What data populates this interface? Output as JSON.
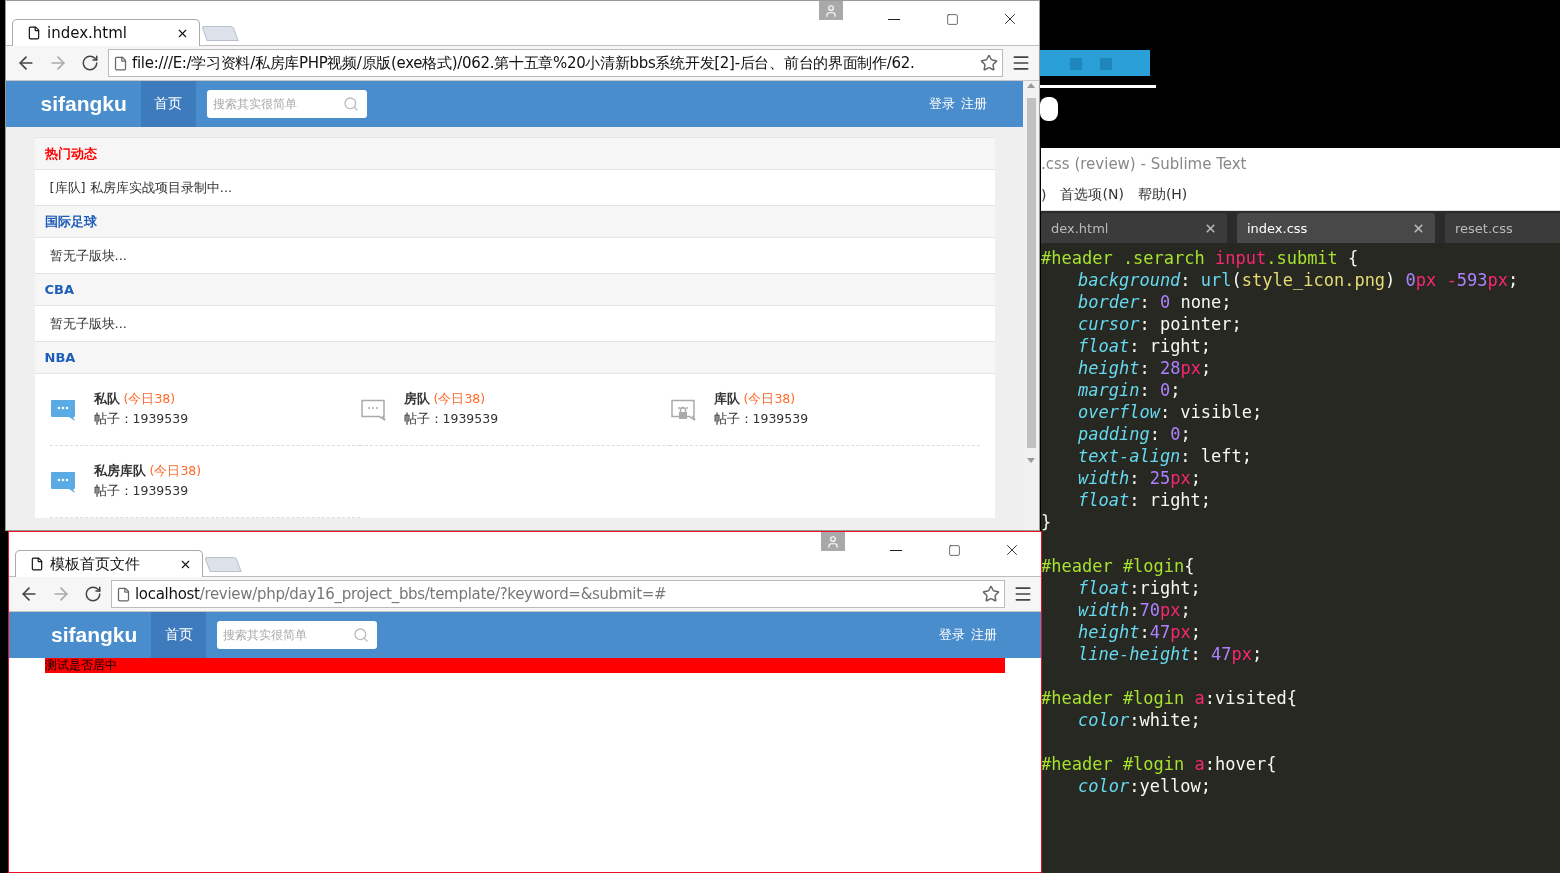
{
  "browsers": [
    {
      "kind": "forum",
      "active": false,
      "tab_title": "index.html",
      "url_parts": [
        {
          "text": "file:///E:/学习资料/私房库PHP视频/原版(exe格式)/062.第十五章%20小清新bbs系统开发[2]-后台、前台的界面制作/62.",
          "dim": false
        }
      ],
      "site": {
        "logo": "sifangku",
        "nav": "首页",
        "search_placeholder": "搜索其实很简单",
        "login": "登录",
        "register": "注册"
      },
      "sections": [
        {
          "title": "热门动态",
          "color": "#ff0000",
          "kind": "text",
          "text": "[库队] 私房库实战项目录制中..."
        },
        {
          "title": "国际足球",
          "color": "#1e5db8",
          "kind": "text",
          "text": "暂无子版块..."
        },
        {
          "title": "CBA",
          "color": "#1e5db8",
          "kind": "text",
          "text": "暂无子版块..."
        },
        {
          "title": "NBA",
          "color": "#1e5db8",
          "kind": "boards",
          "boards": [
            {
              "name": "私队",
              "today": "(今日38)",
              "posts": "帖子：1939539",
              "kind": "new"
            },
            {
              "name": "房队",
              "today": "(今日38)",
              "posts": "帖子：1939539",
              "kind": "plain"
            },
            {
              "name": "库队",
              "today": "(今日38)",
              "posts": "帖子：1939539",
              "kind": "locked"
            },
            {
              "name": "私房库队",
              "today": "(今日38)",
              "posts": "帖子：1939539",
              "kind": "new"
            }
          ]
        }
      ]
    },
    {
      "kind": "test",
      "active": true,
      "tab_title": "模板首页文件",
      "url_parts": [
        {
          "text": "localhost",
          "dim": false
        },
        {
          "text": "/review/php/day16_project_bbs/template/?keyword=&submit=#",
          "dim": true
        }
      ],
      "site": {
        "logo": "sifangku",
        "nav": "首页",
        "search_placeholder": "搜索其实很简单",
        "login": "登录",
        "register": "注册"
      },
      "banner": "测试是否居中"
    }
  ],
  "editor": {
    "title": ".css (review) - Sublime Text",
    "menu": [
      ")",
      "首选项(N)",
      "帮助(H)"
    ],
    "tabs": [
      {
        "label": "dex.html",
        "selected": false
      },
      {
        "label": "index.css",
        "selected": true
      },
      {
        "label": "reset.css",
        "selected": false
      }
    ],
    "blocks": [
      {
        "lines": [
          {
            "indent": false,
            "tokens": [
              {
                "kind": "sel",
                "text": "#header .serarch "
              },
              {
                "kind": "tag",
                "text": "input"
              },
              {
                "kind": "sel",
                "text": ".submit"
              },
              {
                "kind": "plain",
                "text": " {"
              }
            ]
          },
          {
            "indent": true,
            "tokens": [
              {
                "kind": "prop",
                "text": "background"
              },
              {
                "kind": "plain",
                "text": ": "
              },
              {
                "kind": "fn",
                "text": "url"
              },
              {
                "kind": "plain",
                "text": "("
              },
              {
                "kind": "str",
                "text": "style_icon.png"
              },
              {
                "kind": "plain",
                "text": ") "
              },
              {
                "kind": "num",
                "text": "0"
              },
              {
                "kind": "unit",
                "text": "px"
              },
              {
                "kind": "unit",
                "text": " -"
              },
              {
                "kind": "num",
                "text": "593"
              },
              {
                "kind": "unit",
                "text": "px"
              },
              {
                "kind": "plain",
                "text": ";"
              }
            ]
          },
          {
            "indent": true,
            "tokens": [
              {
                "kind": "prop",
                "text": "border"
              },
              {
                "kind": "plain",
                "text": ": "
              },
              {
                "kind": "num",
                "text": "0"
              },
              {
                "kind": "plain",
                "text": " none;"
              }
            ]
          },
          {
            "indent": true,
            "tokens": [
              {
                "kind": "prop",
                "text": "cursor"
              },
              {
                "kind": "plain",
                "text": ": pointer;"
              }
            ]
          },
          {
            "indent": true,
            "tokens": [
              {
                "kind": "prop",
                "text": "float"
              },
              {
                "kind": "plain",
                "text": ": right;"
              }
            ]
          },
          {
            "indent": true,
            "tokens": [
              {
                "kind": "prop",
                "text": "height"
              },
              {
                "kind": "plain",
                "text": ": "
              },
              {
                "kind": "num",
                "text": "28"
              },
              {
                "kind": "unit",
                "text": "px"
              },
              {
                "kind": "plain",
                "text": ";"
              }
            ]
          },
          {
            "indent": true,
            "tokens": [
              {
                "kind": "prop",
                "text": "margin"
              },
              {
                "kind": "plain",
                "text": ": "
              },
              {
                "kind": "num",
                "text": "0"
              },
              {
                "kind": "plain",
                "text": ";"
              }
            ]
          },
          {
            "indent": true,
            "tokens": [
              {
                "kind": "prop",
                "text": "overflow"
              },
              {
                "kind": "plain",
                "text": ": visible;"
              }
            ]
          },
          {
            "indent": true,
            "tokens": [
              {
                "kind": "prop",
                "text": "padding"
              },
              {
                "kind": "plain",
                "text": ": "
              },
              {
                "kind": "num",
                "text": "0"
              },
              {
                "kind": "plain",
                "text": ";"
              }
            ]
          },
          {
            "indent": true,
            "tokens": [
              {
                "kind": "prop",
                "text": "text-align"
              },
              {
                "kind": "plain",
                "text": ": left;"
              }
            ]
          },
          {
            "indent": true,
            "tokens": [
              {
                "kind": "prop",
                "text": "width"
              },
              {
                "kind": "plain",
                "text": ": "
              },
              {
                "kind": "num",
                "text": "25"
              },
              {
                "kind": "unit",
                "text": "px"
              },
              {
                "kind": "plain",
                "text": ";"
              }
            ]
          },
          {
            "indent": true,
            "tokens": [
              {
                "kind": "prop",
                "text": "float"
              },
              {
                "kind": "plain",
                "text": ": right;"
              }
            ]
          },
          {
            "indent": false,
            "tokens": [
              {
                "kind": "plain",
                "text": "}"
              }
            ]
          }
        ]
      },
      {
        "lines": [
          {
            "indent": false,
            "tokens": [
              {
                "kind": "sel",
                "text": "#header #login"
              },
              {
                "kind": "plain",
                "text": "{"
              }
            ]
          },
          {
            "indent": true,
            "tokens": [
              {
                "kind": "prop",
                "text": "float"
              },
              {
                "kind": "plain",
                "text": ":right;"
              }
            ]
          },
          {
            "indent": true,
            "tokens": [
              {
                "kind": "prop",
                "text": "width"
              },
              {
                "kind": "plain",
                "text": ":"
              },
              {
                "kind": "num",
                "text": "70"
              },
              {
                "kind": "unit",
                "text": "px"
              },
              {
                "kind": "plain",
                "text": ";"
              }
            ]
          },
          {
            "indent": true,
            "tokens": [
              {
                "kind": "prop",
                "text": "height"
              },
              {
                "kind": "plain",
                "text": ":"
              },
              {
                "kind": "num",
                "text": "47"
              },
              {
                "kind": "unit",
                "text": "px"
              },
              {
                "kind": "plain",
                "text": ";"
              }
            ]
          },
          {
            "indent": true,
            "tokens": [
              {
                "kind": "prop",
                "text": "line-height"
              },
              {
                "kind": "plain",
                "text": ": "
              },
              {
                "kind": "num",
                "text": "47"
              },
              {
                "kind": "unit",
                "text": "px"
              },
              {
                "kind": "plain",
                "text": ";"
              }
            ]
          }
        ]
      },
      {
        "lines": [
          {
            "indent": false,
            "tokens": [
              {
                "kind": "sel",
                "text": "#header #login "
              },
              {
                "kind": "tag",
                "text": "a"
              },
              {
                "kind": "plain",
                "text": ":visited{"
              }
            ]
          },
          {
            "indent": true,
            "tokens": [
              {
                "kind": "prop",
                "text": "color"
              },
              {
                "kind": "plain",
                "text": ":white;"
              }
            ]
          }
        ]
      },
      {
        "lines": [
          {
            "indent": false,
            "tokens": [
              {
                "kind": "sel",
                "text": "#header #login "
              },
              {
                "kind": "tag",
                "text": "a"
              },
              {
                "kind": "plain",
                "text": ":hover{"
              }
            ]
          },
          {
            "indent": true,
            "tokens": [
              {
                "kind": "prop",
                "text": "color"
              },
              {
                "kind": "plain",
                "text": ":yellow;"
              }
            ]
          }
        ]
      }
    ]
  }
}
